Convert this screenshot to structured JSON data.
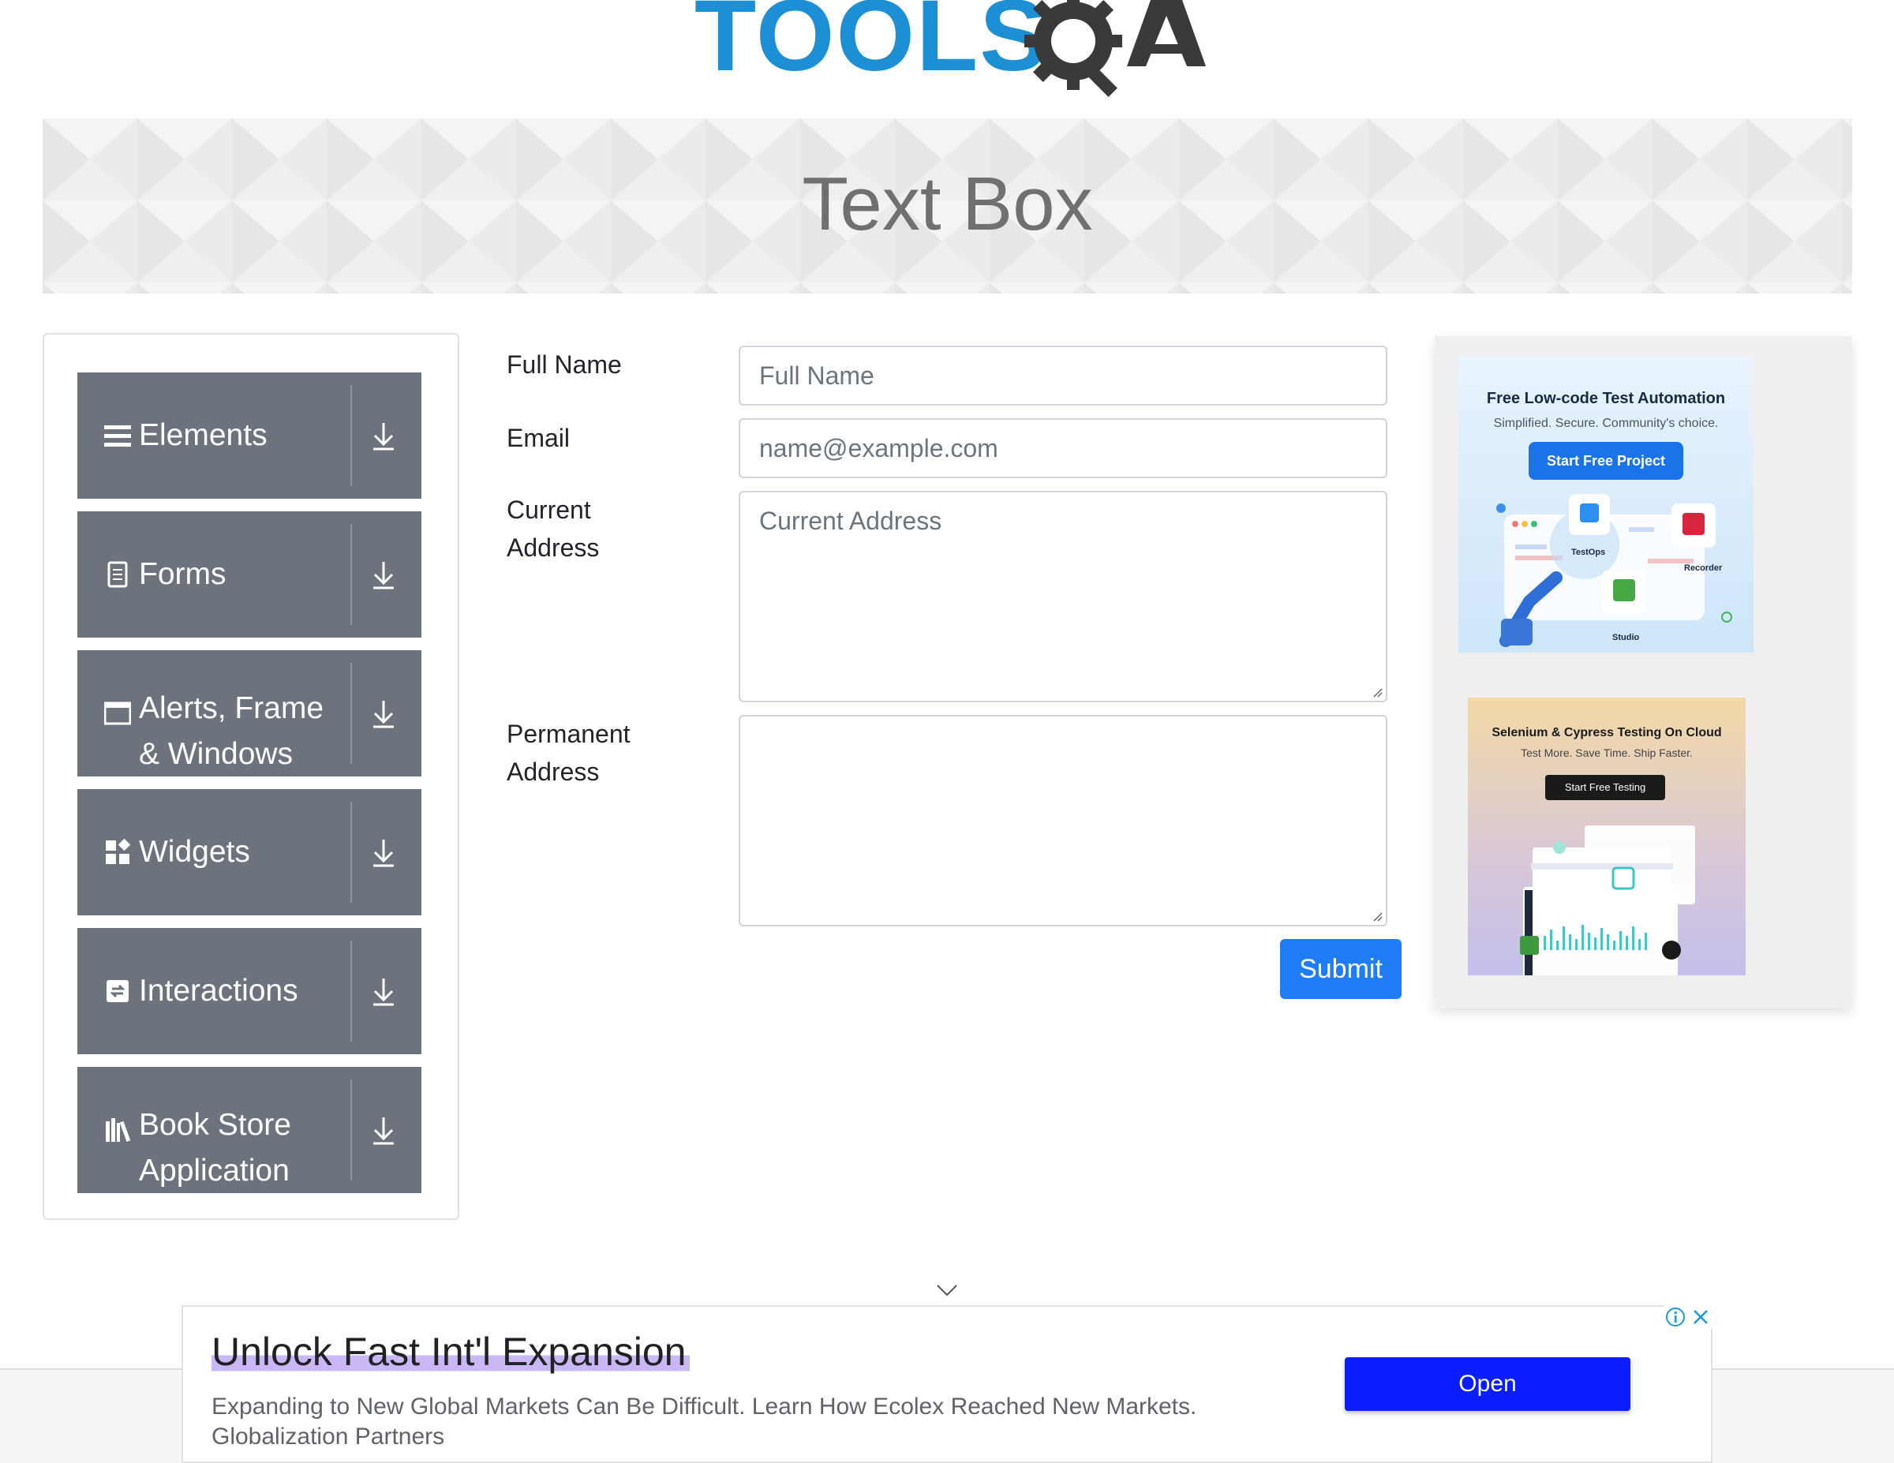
{
  "logo": {
    "wordmark": "TOOLS",
    "suffix": "QA"
  },
  "page_title": "Text Box",
  "sidebar": {
    "groups": [
      {
        "label": "Elements",
        "icon": "hamburger-icon"
      },
      {
        "label": "Forms",
        "icon": "document-icon"
      },
      {
        "label": "Alerts, Frame & Windows",
        "icon": "window-icon"
      },
      {
        "label": "Widgets",
        "icon": "widgets-icon"
      },
      {
        "label": "Interactions",
        "icon": "interactions-icon"
      },
      {
        "label": "Book Store Application",
        "icon": "books-icon"
      }
    ],
    "expand_icon": "download-arrow-icon"
  },
  "form": {
    "full_name": {
      "label": "Full Name",
      "placeholder": "Full Name",
      "value": ""
    },
    "email": {
      "label": "Email",
      "placeholder": "name@example.com",
      "value": ""
    },
    "current_address": {
      "label_line1": "Current",
      "label_line2": "Address",
      "placeholder": "Current Address",
      "value": ""
    },
    "permanent_address": {
      "label_line1": "Permanent",
      "label_line2": "Address",
      "placeholder": "",
      "value": ""
    },
    "submit_label": "Submit"
  },
  "ads": {
    "katalon": {
      "title": "Free Low-code Test Automation",
      "subtitle": "Simplified. Secure. Community's choice.",
      "button": "Start Free Project",
      "nodes": [
        "TestOps",
        "Recorder",
        "Studio"
      ]
    },
    "lambdatest": {
      "title": "Selenium & Cypress Testing On Cloud",
      "subtitle": "Test More. Save Time. Ship Faster.",
      "button": "Start Free Testing"
    },
    "bottom": {
      "headline": "Unlock Fast Int'l Expansion",
      "body_line1": "Expanding to New Global Markets Can Be Difficult. Learn How Ecolex Reached New Markets.",
      "body_line2": "Globalization Partners",
      "button": "Open"
    }
  },
  "colors": {
    "accent": "#1f7ef7",
    "sidebar_group": "#6c737d",
    "logo_blue": "#1d8fd5",
    "ad_button": "#0a1eff"
  }
}
